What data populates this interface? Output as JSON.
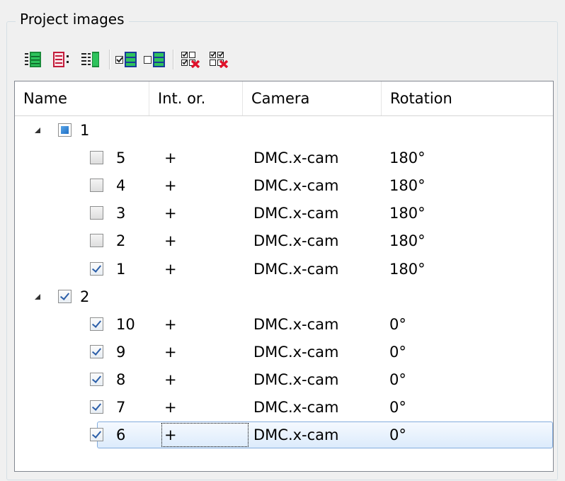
{
  "group": {
    "title": "Project images"
  },
  "toolbar": {
    "buttons": [
      {
        "name": "expand-all-icon"
      },
      {
        "name": "collapse-all-icon"
      },
      {
        "name": "tree-view-icon"
      },
      {
        "name": "check-all-icon"
      },
      {
        "name": "uncheck-all-icon"
      },
      {
        "name": "remove-checked-icon"
      },
      {
        "name": "remove-unchecked-icon"
      }
    ]
  },
  "columns": [
    "Name",
    "Int. or.",
    "Camera",
    "Rotation"
  ],
  "rows": [
    {
      "level": 0,
      "expanded": true,
      "check": "partial",
      "name": "1",
      "int_or": "",
      "camera": "",
      "rotation": ""
    },
    {
      "level": 1,
      "check": "unchecked",
      "name": "5",
      "int_or": "+",
      "camera": "DMC.x-cam",
      "rotation": "180°"
    },
    {
      "level": 1,
      "check": "unchecked",
      "name": "4",
      "int_or": "+",
      "camera": "DMC.x-cam",
      "rotation": "180°"
    },
    {
      "level": 1,
      "check": "unchecked",
      "name": "3",
      "int_or": "+",
      "camera": "DMC.x-cam",
      "rotation": "180°"
    },
    {
      "level": 1,
      "check": "unchecked",
      "name": "2",
      "int_or": "+",
      "camera": "DMC.x-cam",
      "rotation": "180°"
    },
    {
      "level": 1,
      "check": "checked",
      "name": "1",
      "int_or": "+",
      "camera": "DMC.x-cam",
      "rotation": "180°"
    },
    {
      "level": 0,
      "expanded": true,
      "check": "checked",
      "name": "2",
      "int_or": "",
      "camera": "",
      "rotation": ""
    },
    {
      "level": 1,
      "check": "checked",
      "name": "10",
      "int_or": "+",
      "camera": "DMC.x-cam",
      "rotation": "0°"
    },
    {
      "level": 1,
      "check": "checked",
      "name": "9",
      "int_or": "+",
      "camera": "DMC.x-cam",
      "rotation": "0°"
    },
    {
      "level": 1,
      "check": "checked",
      "name": "8",
      "int_or": "+",
      "camera": "DMC.x-cam",
      "rotation": "0°"
    },
    {
      "level": 1,
      "check": "checked",
      "name": "7",
      "int_or": "+",
      "camera": "DMC.x-cam",
      "rotation": "0°"
    },
    {
      "level": 1,
      "check": "checked",
      "name": "6",
      "int_or": "+",
      "camera": "DMC.x-cam",
      "rotation": "0°",
      "selected": true
    }
  ],
  "colors": {
    "selection_border": "#84acdd",
    "partial_fill": "#1f6fc5",
    "check_mark": "#2b5ea8"
  }
}
